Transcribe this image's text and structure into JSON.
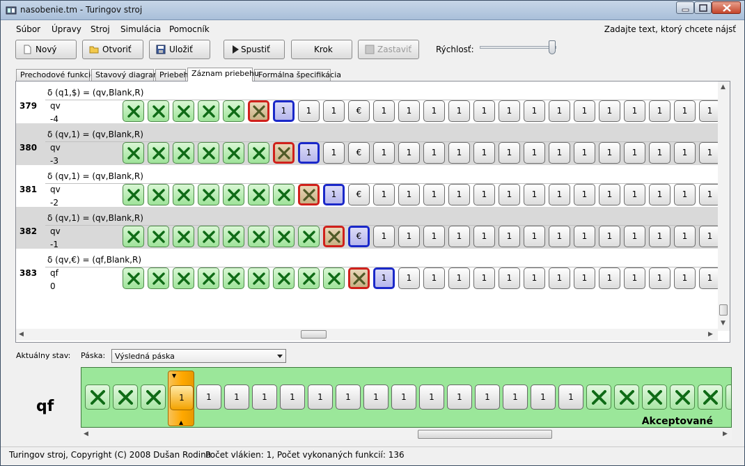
{
  "window": {
    "title": "nasobenie.tm - Turingov stroj"
  },
  "menu": {
    "items": [
      "Súbor",
      "Úpravy",
      "Stroj",
      "Simulácia",
      "Pomocník"
    ],
    "search_hint": "Zadajte text, ktorý chcete nájsť"
  },
  "toolbar": {
    "new": "Nový",
    "open": "Otvoriť",
    "save": "Uložiť",
    "run": "Spustiť",
    "step": "Krok",
    "stop": "Zastaviť",
    "speed_label": "Rýchlosť:"
  },
  "tabs": [
    "Prechodové funkcie",
    "Stavový diagram",
    "Priebeh",
    "Záznam priebehu",
    "Formálna špecifikácia"
  ],
  "active_tab": "Záznam priebehu",
  "records": [
    {
      "num": "379",
      "delta": "δ (q1,$) = (qv,Blank,R)",
      "state": "qv",
      "pos": "-4",
      "blank_count": 6,
      "head_symbol": "1"
    },
    {
      "num": "380",
      "delta": "δ (qv,1) = (qv,Blank,R)",
      "state": "qv",
      "pos": "-3",
      "blank_count": 7,
      "head_symbol": "1"
    },
    {
      "num": "381",
      "delta": "δ (qv,1) = (qv,Blank,R)",
      "state": "qv",
      "pos": "-2",
      "blank_count": 8,
      "head_symbol": "1"
    },
    {
      "num": "382",
      "delta": "δ (qv,1) = (qv,Blank,R)",
      "state": "qv",
      "pos": "-1",
      "blank_count": 9,
      "head_symbol": "€"
    },
    {
      "num": "383",
      "delta": "δ (qv,€) = (qf,Blank,R)",
      "state": "qf",
      "pos": "0",
      "blank_count": 10,
      "head_symbol": "1"
    }
  ],
  "record_tapes": [
    [
      "X",
      "X",
      "X",
      "X",
      "X",
      "X",
      "1",
      "1",
      "1",
      "€",
      "1",
      "1",
      "1",
      "1",
      "1",
      "1",
      "1",
      "1",
      "1",
      "1",
      "1",
      "1",
      "1",
      "1"
    ],
    [
      "X",
      "X",
      "X",
      "X",
      "X",
      "X",
      "X",
      "1",
      "1",
      "€",
      "1",
      "1",
      "1",
      "1",
      "1",
      "1",
      "1",
      "1",
      "1",
      "1",
      "1",
      "1",
      "1",
      "1"
    ],
    [
      "X",
      "X",
      "X",
      "X",
      "X",
      "X",
      "X",
      "X",
      "1",
      "€",
      "1",
      "1",
      "1",
      "1",
      "1",
      "1",
      "1",
      "1",
      "1",
      "1",
      "1",
      "1",
      "1",
      "1"
    ],
    [
      "X",
      "X",
      "X",
      "X",
      "X",
      "X",
      "X",
      "X",
      "X",
      "€",
      "1",
      "1",
      "1",
      "1",
      "1",
      "1",
      "1",
      "1",
      "1",
      "1",
      "1",
      "1",
      "1",
      "1"
    ],
    [
      "X",
      "X",
      "X",
      "X",
      "X",
      "X",
      "X",
      "X",
      "X",
      "X",
      "1",
      "1",
      "1",
      "1",
      "1",
      "1",
      "1",
      "1",
      "1",
      "1",
      "1",
      "1",
      "1",
      "1"
    ]
  ],
  "bottom": {
    "current_state_label": "Aktuálny stav:",
    "tape_label": "Páska:",
    "tape_select": "Výsledná páska",
    "current_state": "qf",
    "result": "Akceptované",
    "tape": [
      "X",
      "X",
      "X",
      "1",
      "1",
      "1",
      "1",
      "1",
      "1",
      "1",
      "1",
      "1",
      "1",
      "1",
      "1",
      "1",
      "1",
      "1",
      "X",
      "X",
      "X",
      "X",
      "X",
      "X"
    ],
    "head_index": 3,
    "head_symbol": "1"
  },
  "status": {
    "copyright": "Turingov stroj, Copyright (C) 2008 Dušan Rodina",
    "counts": "Počet vlákien: 1, Počet vykonaných funkcií: 136"
  },
  "colors": {
    "blank_cell": "#9fe39a",
    "read_border": "#d0201b",
    "head_border": "#1a28c9",
    "tape_background": "#9be79a",
    "head_marker": "#ffa800"
  }
}
